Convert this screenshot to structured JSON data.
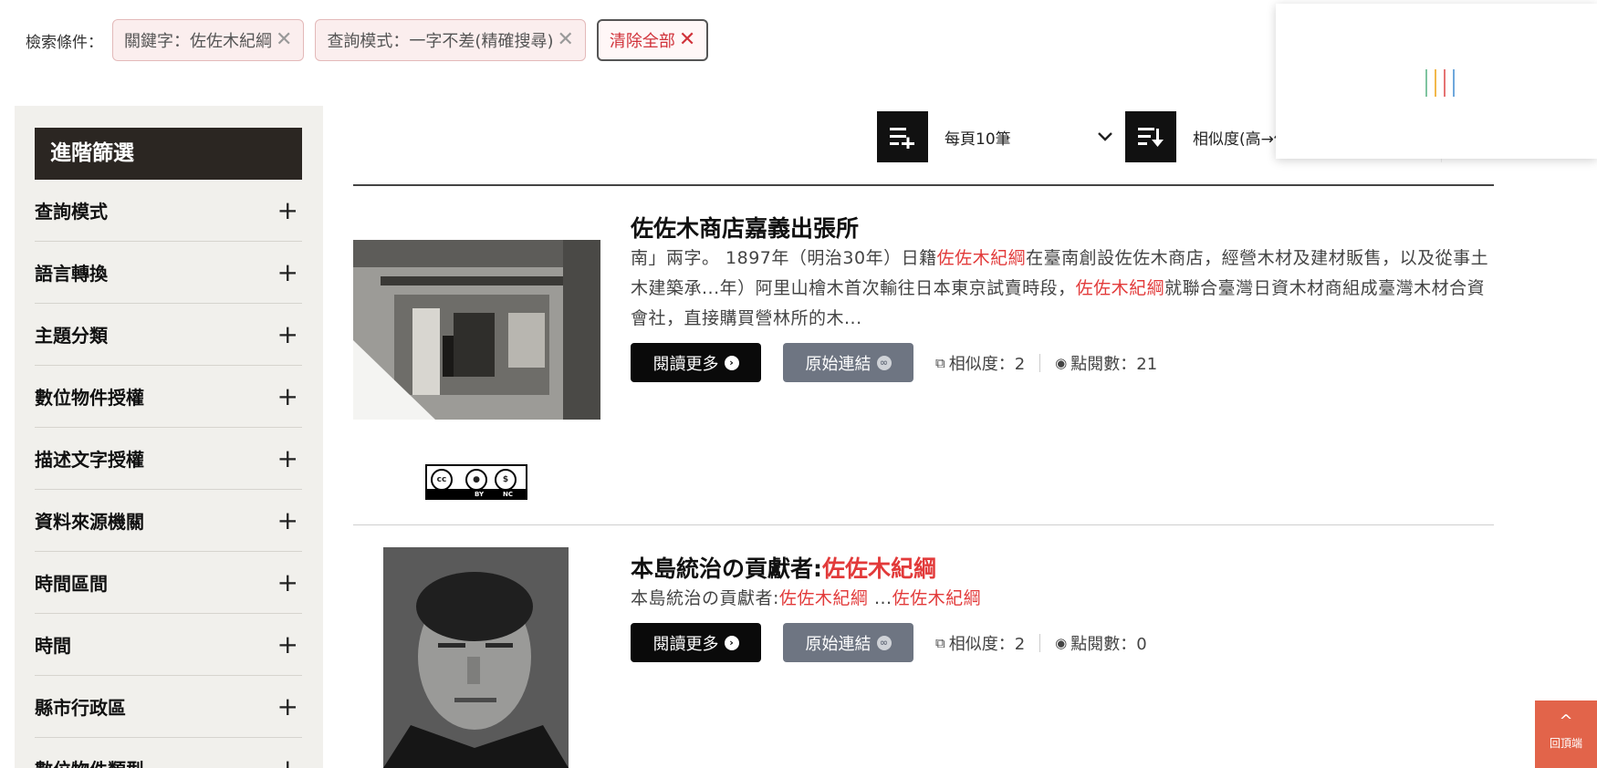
{
  "filters": {
    "label": "檢索條件：",
    "chips": [
      {
        "text": "關鍵字：佐佐木紀綱"
      },
      {
        "text": "查詢模式：一字不差(精確搜尋)"
      }
    ],
    "clear_all": "清除全部",
    "remove_glyph": "✕"
  },
  "sidebar": {
    "title": "進階篩選",
    "items": [
      {
        "label": "查詢模式"
      },
      {
        "label": "語言轉換"
      },
      {
        "label": "主題分類"
      },
      {
        "label": "數位物件授權"
      },
      {
        "label": "描述文字授權"
      },
      {
        "label": "資料來源機關"
      },
      {
        "label": "時間區間"
      },
      {
        "label": "時間"
      },
      {
        "label": "縣市行政區"
      },
      {
        "label": "數位物件類型"
      }
    ],
    "expand_glyph": "+"
  },
  "toolbar": {
    "per_page": "每頁10筆",
    "sort": "相似度(高→低)"
  },
  "results": [
    {
      "title": "佐佐木商店嘉義出張所",
      "snippet_parts": [
        "南」兩字。 1897年（明治30年）日籍",
        "佐佐木紀綱",
        "在臺南創設佐佐木商店，經營木材及建材販售，以及從事土木建築承...年）阿里山檜木首次輸往日本東京試賣時段，",
        "佐佐木紀綱",
        "就聯合臺灣日資木材商組成臺灣木材合資會社，直接購買營林所的木..."
      ],
      "read_more": "閱讀更多",
      "source_link": "原始連結",
      "similarity": "相似度：2",
      "views": "點閱數：21",
      "license": {
        "cc": "cc",
        "by": "BY",
        "nc": "NC"
      }
    },
    {
      "title_prefix": "本島統治の貢獻者:",
      "title_highlight": "佐佐木紀綱",
      "snippet_parts": [
        "本島統治の貢獻者:",
        "佐佐木紀綱",
        " ...",
        "佐佐木紀綱"
      ],
      "read_more": "閱讀更多",
      "source_link": "原始連結",
      "similarity": "相似度：2",
      "views": "點閱數：0"
    }
  ],
  "back_to_top": {
    "label": "回頂端",
    "arrow": "^"
  },
  "colors": {
    "highlight": "#e23a3a",
    "sidebar_bg": "#f1f0ec",
    "sidebar_title_bg": "#2b2622",
    "back_to_top_bg": "#e2644a",
    "loader_bars": [
      "#7fc4a0",
      "#f2b84b",
      "#e57373",
      "#6fa8dc"
    ]
  },
  "icons": {
    "per_page": "list-add-icon",
    "sort": "sort-desc-icon",
    "read_more": "chevron-circle-right-icon",
    "source_link": "link-circle-icon",
    "similarity": "copy-icon",
    "views": "eye-icon"
  }
}
